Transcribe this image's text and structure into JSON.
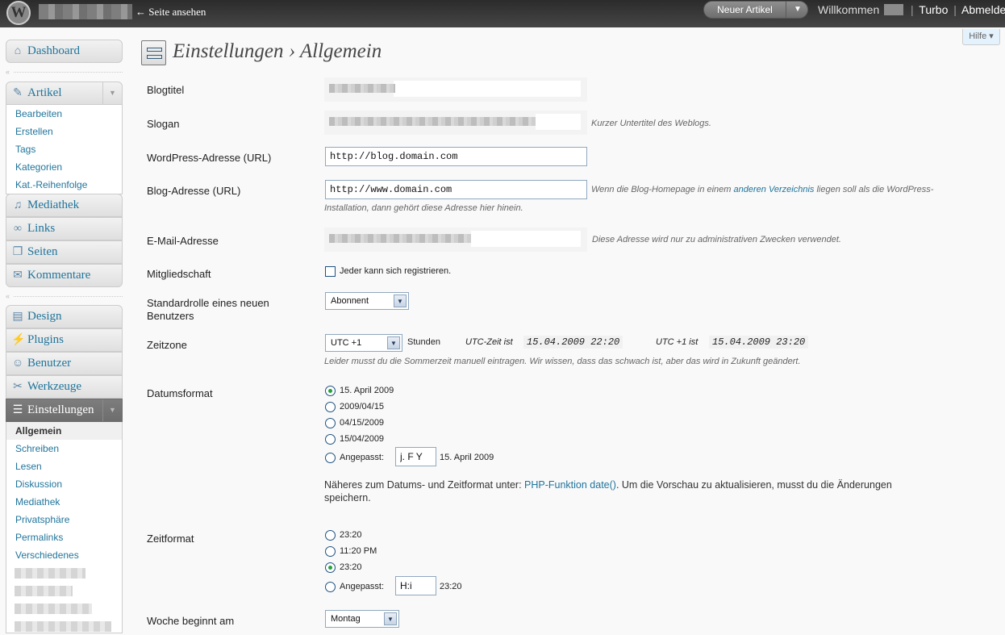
{
  "header": {
    "view_site": "← Seite ansehen",
    "new_post": "Neuer Artikel",
    "welcome": "Willkommen",
    "turbo": "Turbo",
    "logout": "Abmelden",
    "separator": "|"
  },
  "help": "Hilfe ▾",
  "menu": {
    "dashboard": "Dashboard",
    "posts": "Artikel",
    "posts_sub": [
      "Bearbeiten",
      "Erstellen",
      "Tags",
      "Kategorien",
      "Kat.-Reihenfolge"
    ],
    "media": "Mediathek",
    "links": "Links",
    "pages": "Seiten",
    "comments": "Kommentare",
    "design": "Design",
    "plugins": "Plugins",
    "users": "Benutzer",
    "tools": "Werkzeuge",
    "settings": "Einstellungen",
    "settings_sub": [
      "Allgemein",
      "Schreiben",
      "Lesen",
      "Diskussion",
      "Mediathek",
      "Privatsphäre",
      "Permalinks",
      "Verschiedenes"
    ]
  },
  "page": {
    "title": "Einstellungen › Allgemein"
  },
  "form": {
    "blogtitle_label": "Blogtitel",
    "slogan_label": "Slogan",
    "slogan_desc": "Kurzer Untertitel des Weblogs.",
    "wpurl_label": "WordPress-Adresse (URL)",
    "wpurl_value": "http://blog.domain.com",
    "blogurl_label": "Blog-Adresse (URL)",
    "blogurl_value": "http://www.domain.com",
    "blogurl_desc_1": "Wenn die Blog-Homepage in einem ",
    "blogurl_desc_link": "anderen Verzeichnis",
    "blogurl_desc_2": " liegen soll als die WordPress-",
    "blogurl_desc_3": "Installation, dann gehört diese Adresse hier hinein.",
    "email_label": "E-Mail-Adresse",
    "email_desc": "Diese Adresse wird nur zu administrativen Zwecken verwendet.",
    "membership_label": "Mitgliedschaft",
    "membership_option": "Jeder kann sich registrieren.",
    "role_label": "Standardrolle eines neuen Benutzers",
    "role_value": "Abonnent",
    "tz_label": "Zeitzone",
    "tz_value": "UTC +1",
    "tz_hours": "Stunden",
    "utc_label": "UTC-Zeit ist",
    "utc_time": "15.04.2009 22:20",
    "local_label": "UTC +1 ist",
    "local_time": "15.04.2009 23:20",
    "tz_note": "Leider musst du die Sommerzeit manuell eintragen. Wir wissen, dass das schwach ist, aber das wird in Zukunft geändert.",
    "dateformat_label": "Datumsformat",
    "date_options": [
      "15. April 2009",
      "2009/04/15",
      "04/15/2009",
      "15/04/2009"
    ],
    "custom_label": "Angepasst:",
    "date_custom_value": "j. F Y",
    "date_custom_preview": "15. April 2009",
    "date_help_1": "Näheres zum Datums- und Zeitformat unter: ",
    "date_help_link": "PHP-Funktion date()",
    "date_help_2": ". Um die Vorschau zu aktualisieren, musst du die Änderungen",
    "date_help_3": "speichern.",
    "timeformat_label": "Zeitformat",
    "time_options": [
      "23:20",
      "11:20 PM",
      "23:20"
    ],
    "time_custom_value": "H:i",
    "time_custom_preview": "23:20",
    "weekstart_label": "Woche beginnt am",
    "weekstart_value": "Montag"
  }
}
